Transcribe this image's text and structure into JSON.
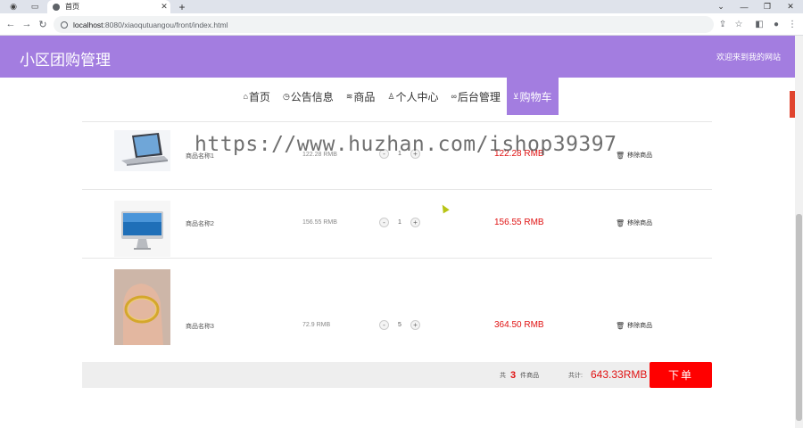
{
  "browser": {
    "tab_title": "首页",
    "url_host": "localhost",
    "url_path": ":8080/xiaoqutuangou/front/index.html"
  },
  "header": {
    "site_title": "小区团购管理",
    "welcome": "欢迎来到我的网站"
  },
  "nav": {
    "items": [
      {
        "icon": "home-icon",
        "glyph": "⌂",
        "label": "首页",
        "active": false
      },
      {
        "icon": "notice-icon",
        "glyph": "◷",
        "label": "公告信息",
        "active": false
      },
      {
        "icon": "goods-icon",
        "glyph": "≋",
        "label": "商品",
        "active": false
      },
      {
        "icon": "user-icon",
        "glyph": "♙",
        "label": "个人中心",
        "active": false
      },
      {
        "icon": "link-icon",
        "glyph": "∞",
        "label": "后台管理",
        "active": false
      },
      {
        "icon": "cart-icon",
        "glyph": "⊻",
        "label": "购物车",
        "active": true
      }
    ]
  },
  "cart": {
    "remove_label": "移除商品",
    "items": [
      {
        "name": "商品名称1",
        "price": "122.28 RMB",
        "qty": "1",
        "subtotal": "122.28 RMB",
        "image": "laptop"
      },
      {
        "name": "商品名称2",
        "price": "156.55 RMB",
        "qty": "1",
        "subtotal": "156.55 RMB",
        "image": "imac"
      },
      {
        "name": "商品名称3",
        "price": "72.9 RMB",
        "qty": "5",
        "subtotal": "364.50 RMB",
        "image": "bracelet"
      }
    ],
    "minus": "-",
    "plus": "+"
  },
  "summary": {
    "count_prefix": "共",
    "count": "3",
    "count_suffix": "件商品",
    "total_label": "共计:",
    "total": "643.33RMB",
    "order_button": "下单"
  },
  "watermark": "https://www.huzhan.com/ishop39397",
  "colors": {
    "header": "#a37de0",
    "price_red": "#e01212",
    "order_button": "#ff0000"
  }
}
